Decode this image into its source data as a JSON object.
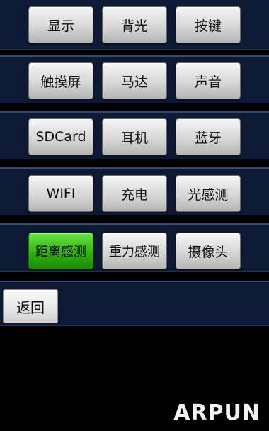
{
  "rows": [
    {
      "buttons": [
        "显示",
        "背光",
        "按键"
      ]
    },
    {
      "buttons": [
        "触摸屏",
        "马达",
        "声音"
      ]
    },
    {
      "buttons": [
        "SDCard",
        "耳机",
        "蓝牙"
      ]
    },
    {
      "buttons": [
        "WIFI",
        "充电",
        "光感测"
      ]
    },
    {
      "buttons": [
        "距离感测",
        "重力感测",
        "摄像头"
      ]
    }
  ],
  "back_label": "返回",
  "watermark": "ARPUN",
  "colors": {
    "panel": "#0e1a33",
    "active_button": "#2fb40c",
    "background": "#000000"
  }
}
